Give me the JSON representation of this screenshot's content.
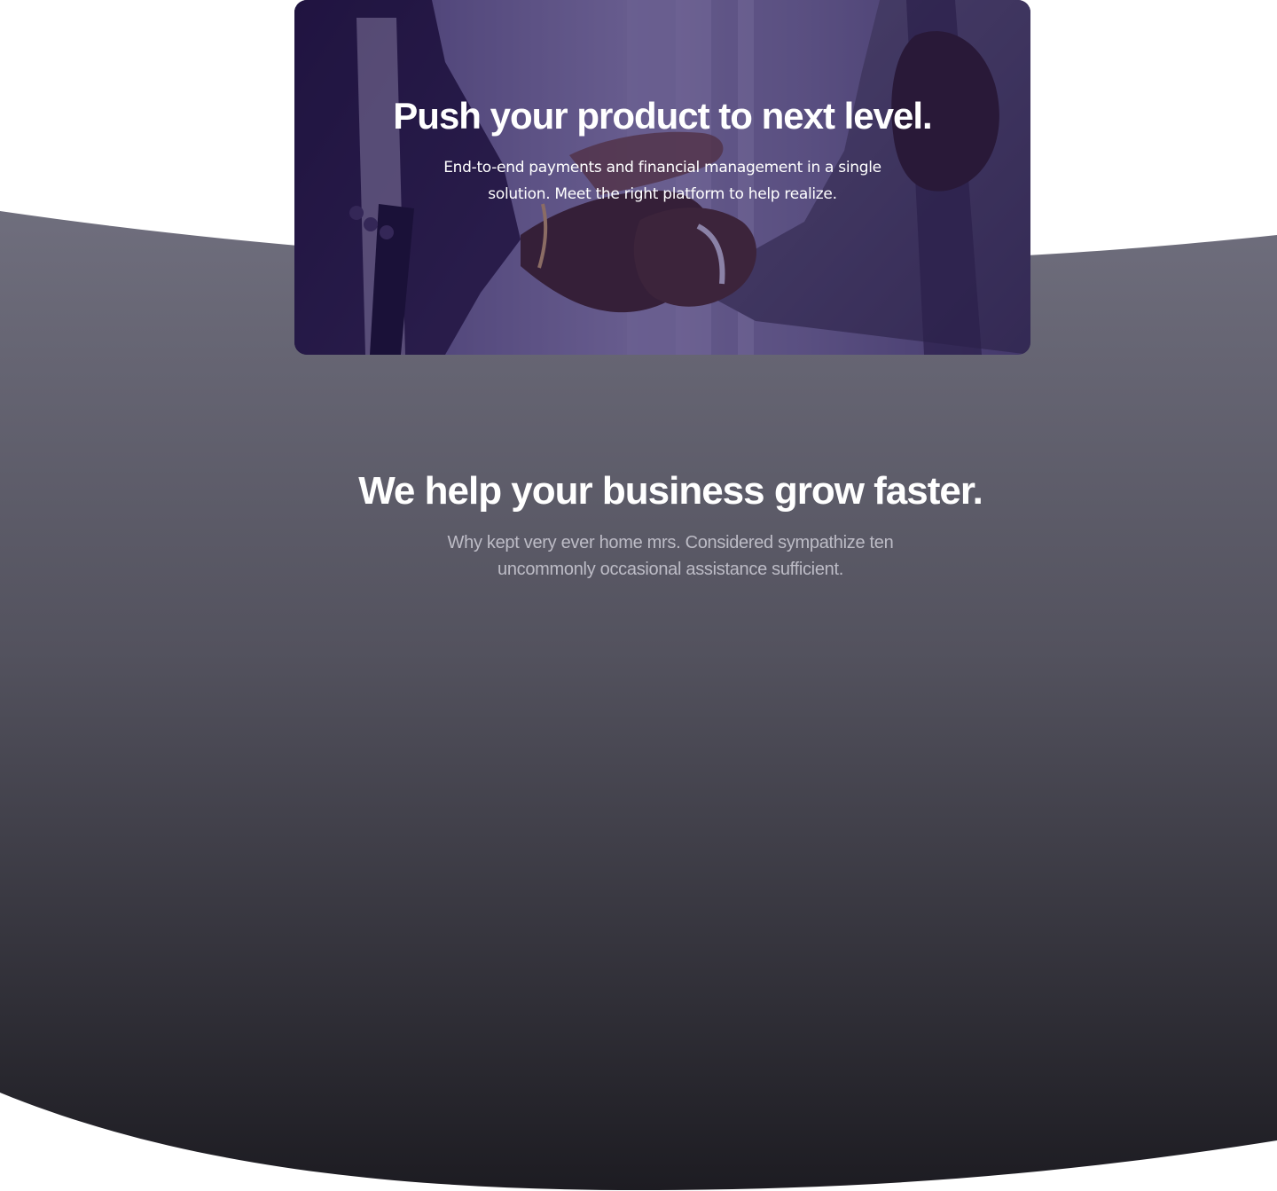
{
  "cta": {
    "title": "Push your product to next level.",
    "subtitle": "End-to-end payments and financial management in a single solution. Meet the right platform to help realize.",
    "image_subject": "handshake-photo"
  },
  "growth": {
    "title": "We help your business grow faster.",
    "subtitle": "Why kept very ever home mrs. Considered sympathize ten uncommonly occasional assistance sufficient."
  },
  "colors": {
    "overlay": "#28185c",
    "section_top": "#6f6e7d",
    "section_bottom": "#1d1c22",
    "text_light": "#ffffff",
    "text_muted": "#bdbcc6"
  }
}
